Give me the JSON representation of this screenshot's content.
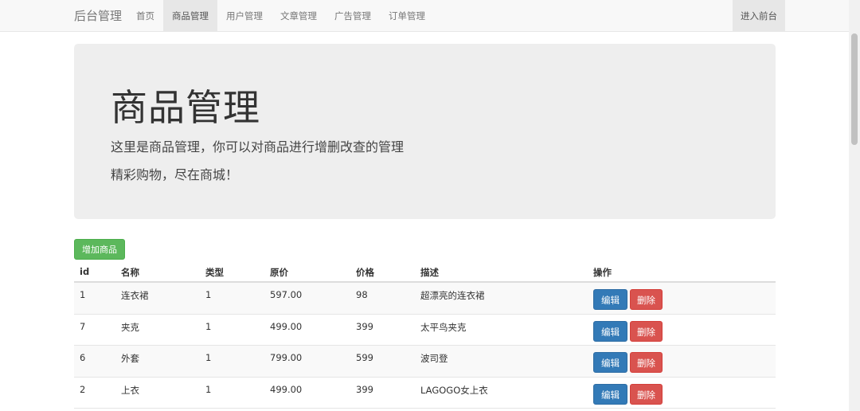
{
  "navbar": {
    "brand": "后台管理",
    "items": [
      "首页",
      "商品管理",
      "用户管理",
      "文章管理",
      "广告管理",
      "订单管理"
    ],
    "active_index": 1,
    "right_link": "进入前台"
  },
  "jumbotron": {
    "title": "商品管理",
    "subtitle1": "这里是商品管理，你可以对商品进行增删改查的管理",
    "subtitle2": "精彩购物，尽在商城！"
  },
  "actions": {
    "add_label": "增加商品"
  },
  "table": {
    "headers": [
      "id",
      "名称",
      "类型",
      "原价",
      "价格",
      "描述",
      "操作"
    ],
    "rows": [
      {
        "id": "1",
        "name": "连衣裙",
        "type": "1",
        "original_price": "597.00",
        "price": "98",
        "desc": "超漂亮的连衣裙"
      },
      {
        "id": "7",
        "name": "夹克",
        "type": "1",
        "original_price": "499.00",
        "price": "399",
        "desc": "太平鸟夹克"
      },
      {
        "id": "6",
        "name": "外套",
        "type": "1",
        "original_price": "799.00",
        "price": "599",
        "desc": "波司登"
      },
      {
        "id": "2",
        "name": "上衣",
        "type": "1",
        "original_price": "499.00",
        "price": "399",
        "desc": "LAGOGO女上衣"
      }
    ],
    "edit_label": "编辑",
    "delete_label": "删除"
  },
  "colors": {
    "success": "#5cb85c",
    "primary": "#337ab7",
    "danger": "#d9534f",
    "jumbotron_bg": "#eeeeee",
    "navbar_bg": "#f8f8f8"
  }
}
